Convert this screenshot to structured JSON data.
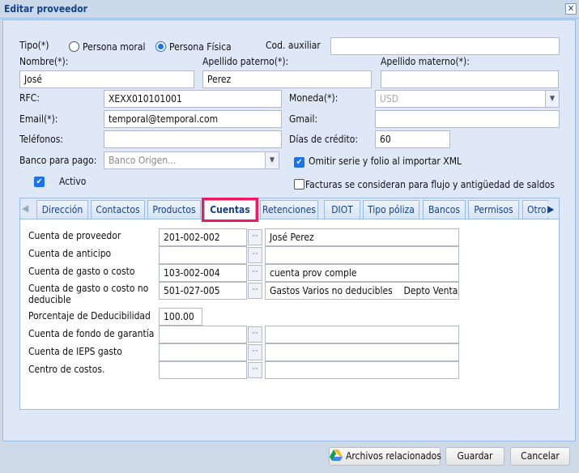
{
  "window": {
    "title": "Editar proveedor",
    "close": "✕"
  },
  "form": {
    "tipo_label": "Tipo(*)",
    "tipo_options": [
      "Persona moral",
      "Persona Física"
    ],
    "tipo_selected": "Persona Física",
    "cod_auxiliar_label": "Cod. auxiliar",
    "cod_auxiliar": "",
    "nombre_label": "Nombre(*):",
    "nombre": "José",
    "apellido_paterno_label": "Apellido paterno(*):",
    "apellido_paterno": "Perez",
    "apellido_materno_label": "Apellido materno(*):",
    "apellido_materno": "",
    "rfc_label": "RFC:",
    "rfc": "XEXX010101001",
    "moneda_label": "Moneda(*):",
    "moneda": "USD",
    "email_label": "Email(*):",
    "email": "temporal@temporal.com",
    "gmail_label": "Gmail:",
    "gmail": "",
    "telefonos_label": "Teléfonos:",
    "telefonos": "",
    "dias_credito_label": "Días de crédito:",
    "dias_credito": "60",
    "banco_label": "Banco para pago:",
    "banco_placeholder": "Banco Origen...",
    "omitir_label": "Omitir serie y folio al importar XML",
    "omitir_checked": true,
    "activo_label": "Activo",
    "activo_checked": true,
    "facturas_label": "Facturas se consideran para flujo y antigüedad de saldos",
    "facturas_checked": false
  },
  "tabs": [
    "Dirección",
    "Contactos",
    "Productos",
    "Cuentas",
    "Retenciones",
    "DIOT",
    "Tipo póliza",
    "Bancos",
    "Permisos",
    "Otro"
  ],
  "active_tab": "Cuentas",
  "cuentas": [
    {
      "label": "Cuenta de proveedor",
      "code": "201-002-002",
      "desc": "José Perez"
    },
    {
      "label": "Cuenta de anticipo",
      "code": "",
      "desc": ""
    },
    {
      "label": "Cuenta de gasto o costo",
      "code": "103-002-004",
      "desc": "cuenta prov comple"
    },
    {
      "label": "Cuenta de gasto o costo no deducible",
      "code": "501-027-005",
      "desc": "Gastos Varios no deducibles    Depto Ventas"
    },
    {
      "label": "Porcentaje de Deducibilidad",
      "value": "100.00"
    },
    {
      "label": "Cuenta de fondo de garantía",
      "code": "",
      "desc": ""
    },
    {
      "label": "Cuenta de IEPS gasto",
      "code": "",
      "desc": ""
    },
    {
      "label": "Centro de costos.",
      "code": "",
      "desc": ""
    }
  ],
  "buttons": {
    "archivos": "Archivos relacionados",
    "guardar": "Guardar",
    "cancelar": "Cancelar",
    "lookup": "···"
  },
  "colors": {
    "accent": "#1a73e8",
    "highlight": "#f0195f",
    "title": "#15428b"
  }
}
